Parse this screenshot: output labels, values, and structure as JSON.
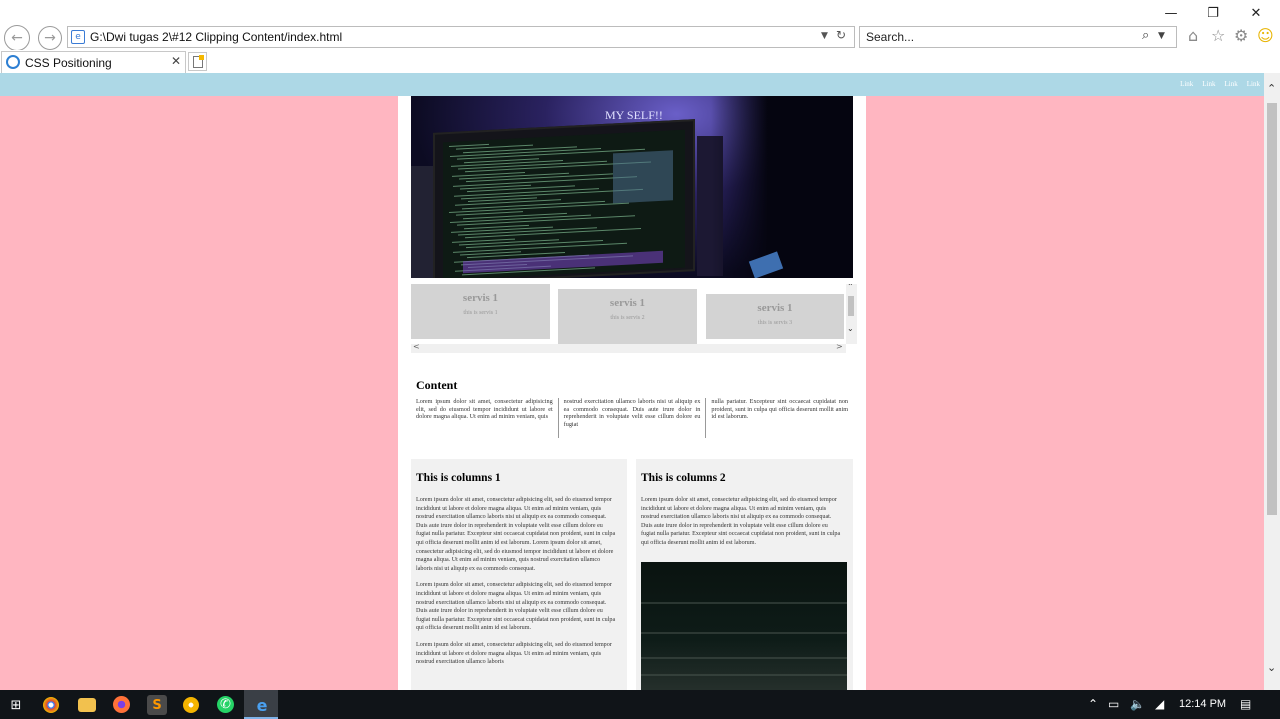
{
  "browser": {
    "url": "G:\\Dwi tugas 2\\#12 Clipping Content/index.html",
    "search_placeholder": "Search...",
    "tab_title": "CSS Positioning",
    "window_controls": [
      "minimize-icon",
      "restore-icon",
      "close-icon"
    ],
    "toolbar_icons": [
      "home-icon",
      "favorites-star-icon",
      "settings-gear-icon",
      "feedback-smiley-icon"
    ]
  },
  "page": {
    "nav_links": [
      "Link",
      "Link",
      "Link",
      "Link"
    ],
    "hero_caption": "MY SELF!!",
    "services": [
      {
        "title": "servis 1",
        "text": "this is servis 1"
      },
      {
        "title": "servis 1",
        "text": "this is servis 2"
      },
      {
        "title": "servis 1",
        "text": "this is servis 3"
      }
    ],
    "content": {
      "heading": "Content",
      "columns": [
        "Lorem ipsum dolor sit amet, consectetur adipisicing elit, sed do eiusmod tempor incididunt ut labore et dolore magna aliqua. Ut enim ad minim veniam, quis",
        "nostrud exercitation ullamco laboris nisi ut aliquip ex ea commodo consequat. Duis aute irure dolor in reprehenderit in voluptate velit esse cillum dolore eu fugiat",
        "nulla pariatur. Excepteur sint occaecat cupidatat non proident, sunt in culpa qui officia deserunt mollit anim id est laborum."
      ]
    },
    "col1": {
      "heading": "This is columns 1",
      "paragraphs": [
        "Lorem ipsum dolor sit amet, consectetur adipisicing elit, sed do eiusmod tempor incididunt ut labore et dolore magna aliqua. Ut enim ad minim veniam, quis nostrud exercitation ullamco laboris nisi ut aliquip ex ea commodo consequat. Duis aute irure dolor in reprehenderit in voluptate velit esse cillum dolore eu fugiat nulla pariatur. Excepteur sint occaecat cupidatat non proident, sunt in culpa qui officia deserunt mollit anim id est laborum. Lorem ipsum dolor sit amet, consectetur adipisicing elit, sed do eiusmod tempor incididunt ut labore et dolore magna aliqua. Ut enim ad minim veniam, quis nostrud exercitation ullamco laboris nisi ut aliquip ex ea commodo consequat.",
        "Lorem ipsum dolor sit amet, consectetur adipisicing elit, sed do eiusmod tempor incididunt ut labore et dolore magna aliqua. Ut enim ad minim veniam, quis nostrud exercitation ullamco laboris nisi ut aliquip ex ea commodo consequat. Duis aute irure dolor in reprehenderit in voluptate velit esse cillum dolore eu fugiat nulla pariatur. Excepteur sint occaecat cupidatat non proident, sunt in culpa qui officia deserunt mollit anim id est laborum.",
        "Lorem ipsum dolor sit amet, consectetur adipisicing elit, sed do eiusmod tempor incididunt ut labore et dolore magna aliqua. Ut enim ad minim veniam, quis nostrud exercitation ullamco laboris"
      ]
    },
    "col2": {
      "heading": "This is columns 2",
      "paragraphs": [
        "Lorem ipsum dolor sit amet, consectetur adipisicing elit, sed do eiusmod tempor incididunt ut labore et dolore magna aliqua. Ut enim ad minim veniam, quis nostrud exercitation ullamco laboris nisi ut aliquip ex ea commodo consequat. Duis aute irure dolor in reprehenderit in voluptate velit esse cillum dolore eu fugiat nulla pariatur. Excepteur sint occaecat cupidatat non proident, sunt in culpa qui officia deserunt mollit anim id est laborum."
      ]
    },
    "colors": {
      "page_background": "#ffb6c1",
      "nav_background": "#add8e6",
      "service_box": "#d3d3d3",
      "column_background": "#f1f1f1"
    }
  },
  "taskbar": {
    "apps": [
      "windows-start-icon",
      "chrome-icon",
      "file-explorer-icon",
      "firefox-icon",
      "sublime-text-icon",
      "chrome-canary-icon",
      "whatsapp-icon",
      "internet-explorer-icon"
    ],
    "clock": "12:14 PM"
  }
}
